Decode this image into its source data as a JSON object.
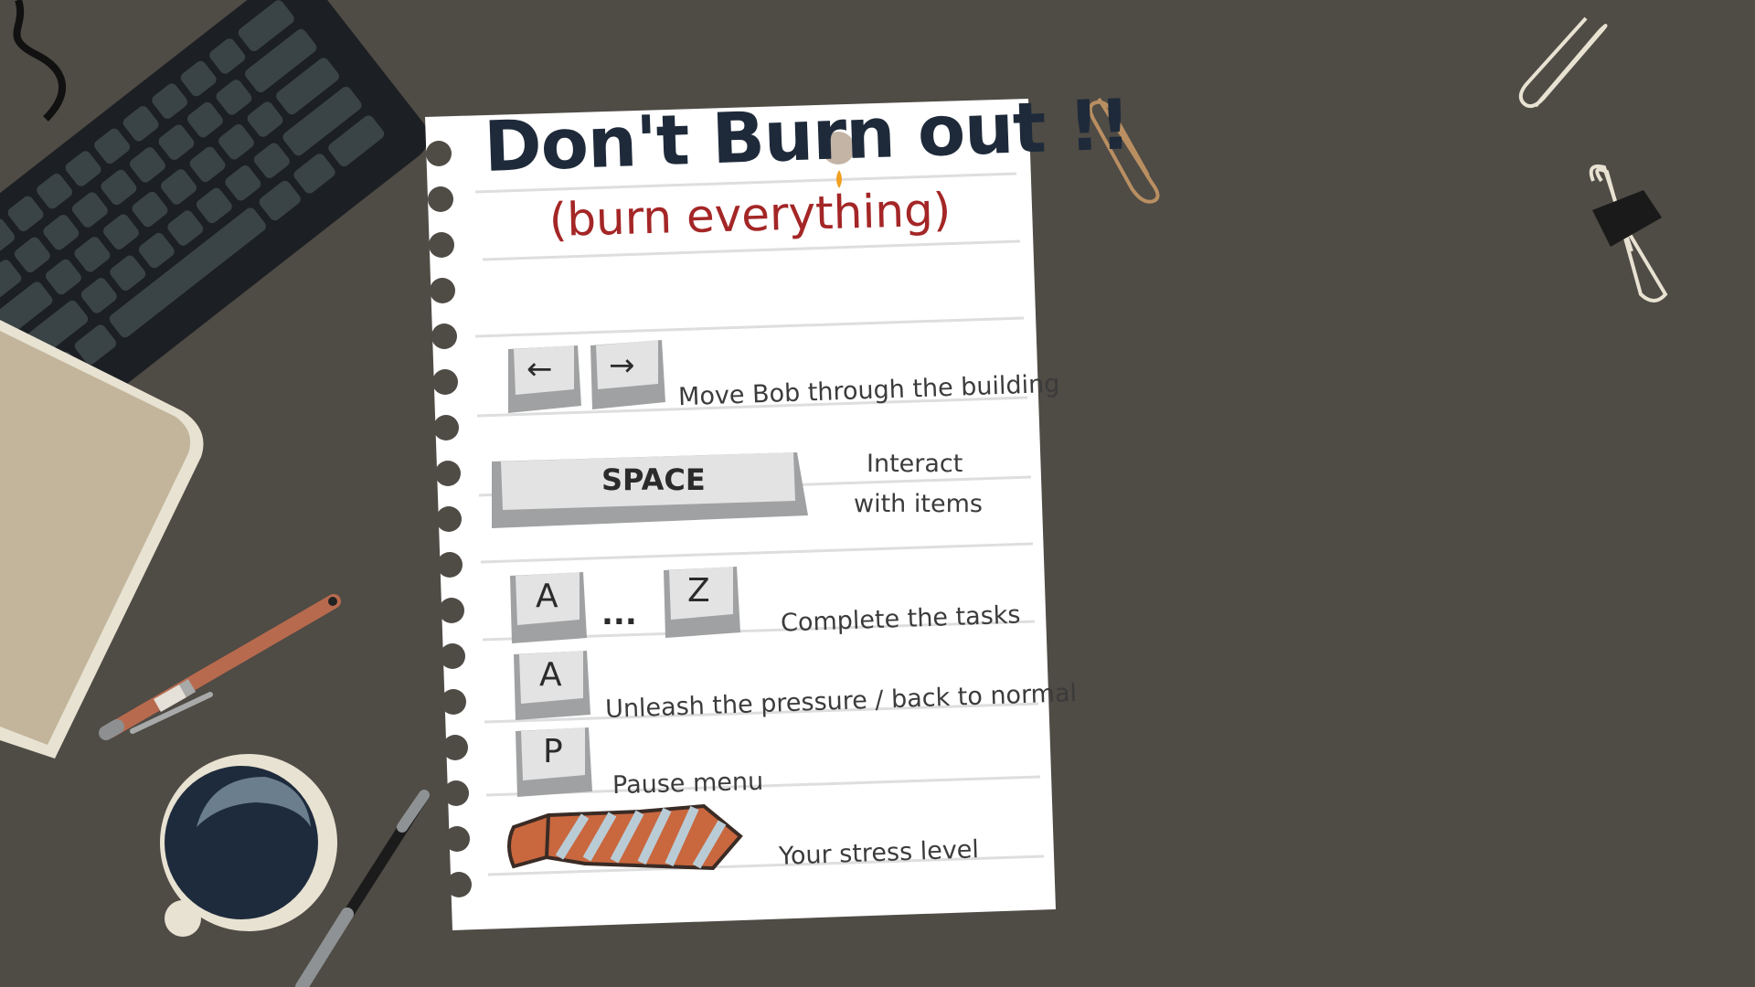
{
  "title": {
    "main": "Don't Burn out !!",
    "subtitle": "(burn everything)"
  },
  "controls": [
    {
      "keys": [
        "←",
        "→"
      ],
      "description": "Move Bob through the building"
    },
    {
      "keys": [
        "SPACE"
      ],
      "description_line1": "Interact",
      "description_line2": "with items"
    },
    {
      "keys": [
        "A",
        "...",
        "Z"
      ],
      "description": "Complete the tasks"
    },
    {
      "keys": [
        "A"
      ],
      "description": "Unleash the pressure / back to normal"
    },
    {
      "keys": [
        "P"
      ],
      "description": "Pause menu"
    },
    {
      "icon": "striped-tie-icon",
      "description": "Your stress level"
    }
  ],
  "colors": {
    "desk": "#4f4b45",
    "paper": "#ffffff",
    "title": "#1e2a3a",
    "subtitle": "#a42626",
    "tie_orange": "#c9673e",
    "tie_blue": "#b9ccd6"
  }
}
